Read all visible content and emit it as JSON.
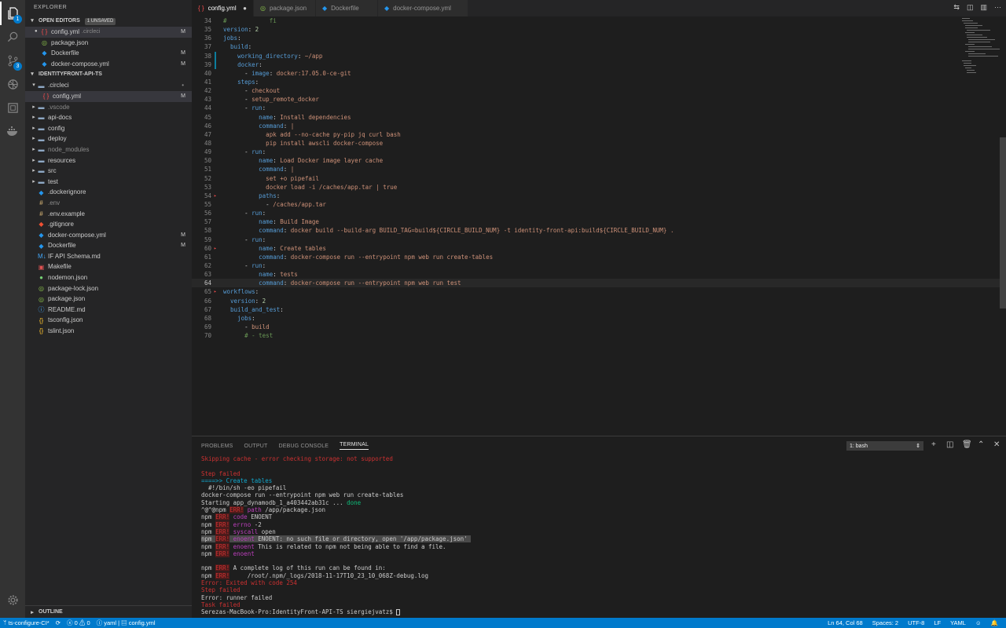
{
  "sidebar": {
    "title": "EXPLORER",
    "open_editors_label": "OPEN EDITORS",
    "unsaved_badge": "1 UNSAVED",
    "open_editors": [
      {
        "name": "config.yml",
        "detail": ".circleci",
        "flag": "M",
        "icon": "yaml-icon",
        "dirty": true
      },
      {
        "name": "package.json",
        "detail": "",
        "flag": "",
        "icon": "npm-icon",
        "dirty": false
      },
      {
        "name": "Dockerfile",
        "detail": "",
        "flag": "M",
        "icon": "docker-icon",
        "dirty": false
      },
      {
        "name": "docker-compose.yml",
        "detail": "",
        "flag": "M",
        "icon": "docker-icon",
        "dirty": false
      }
    ],
    "project_label": "IDENTITYFRONT-API-TS",
    "tree": [
      {
        "name": ".circleci",
        "type": "folder-open",
        "flag": "•",
        "indent": 0
      },
      {
        "name": "config.yml",
        "type": "yaml",
        "flag": "M",
        "indent": 1,
        "selected": true
      },
      {
        "name": ".vscode",
        "type": "folder",
        "flag": "",
        "indent": 0
      },
      {
        "name": "api-docs",
        "type": "folder",
        "flag": "",
        "indent": 0
      },
      {
        "name": "config",
        "type": "folder",
        "flag": "",
        "indent": 0
      },
      {
        "name": "deploy",
        "type": "folder",
        "flag": "",
        "indent": 0
      },
      {
        "name": "node_modules",
        "type": "folder",
        "flag": "",
        "indent": 0
      },
      {
        "name": "resources",
        "type": "folder",
        "flag": "",
        "indent": 0
      },
      {
        "name": "src",
        "type": "folder",
        "flag": "",
        "indent": 0
      },
      {
        "name": "test",
        "type": "folder",
        "flag": "",
        "indent": 0
      },
      {
        "name": ".dockerignore",
        "type": "docker",
        "flag": "",
        "indent": 0
      },
      {
        "name": ".env",
        "type": "env",
        "flag": "",
        "indent": 0
      },
      {
        "name": ".env.example",
        "type": "env",
        "flag": "",
        "indent": 0
      },
      {
        "name": ".gitignore",
        "type": "git",
        "flag": "",
        "indent": 0
      },
      {
        "name": "docker-compose.yml",
        "type": "docker",
        "flag": "M",
        "indent": 0
      },
      {
        "name": "Dockerfile",
        "type": "docker",
        "flag": "M",
        "indent": 0
      },
      {
        "name": "IF API Schema.md",
        "type": "md",
        "flag": "",
        "indent": 0
      },
      {
        "name": "Makefile",
        "type": "make",
        "flag": "",
        "indent": 0
      },
      {
        "name": "nodemon.json",
        "type": "nodemon",
        "flag": "",
        "indent": 0
      },
      {
        "name": "package-lock.json",
        "type": "npm",
        "flag": "",
        "indent": 0
      },
      {
        "name": "package.json",
        "type": "npm",
        "flag": "",
        "indent": 0
      },
      {
        "name": "README.md",
        "type": "info",
        "flag": "",
        "indent": 0
      },
      {
        "name": "tsconfig.json",
        "type": "json",
        "flag": "",
        "indent": 0
      },
      {
        "name": "tslint.json",
        "type": "json",
        "flag": "",
        "indent": 0
      }
    ],
    "outline_label": "OUTLINE"
  },
  "activity": {
    "explorer_badge": "1",
    "scm_badge": "3"
  },
  "tabs": [
    {
      "label": "config.yml",
      "active": true,
      "dirty": "●",
      "icon": "yaml-icon"
    },
    {
      "label": "package.json",
      "active": false,
      "dirty": "",
      "icon": "npm-icon"
    },
    {
      "label": "Dockerfile",
      "active": false,
      "dirty": "",
      "icon": "docker-icon"
    },
    {
      "label": "docker-compose.yml",
      "active": false,
      "dirty": "",
      "icon": "docker-icon"
    }
  ],
  "editor": {
    "current_line": "64",
    "lines": [
      {
        "n": "34",
        "t": "#            fi"
      },
      {
        "n": "35",
        "t": "version: 2"
      },
      {
        "n": "36",
        "t": "jobs:"
      },
      {
        "n": "37",
        "t": "  build:"
      },
      {
        "n": "38",
        "t": "    working_directory: ~/app"
      },
      {
        "n": "39",
        "t": "    docker:"
      },
      {
        "n": "40",
        "t": "      - image: docker:17.05.0-ce-git"
      },
      {
        "n": "41",
        "t": "    steps:"
      },
      {
        "n": "42",
        "t": "      - checkout"
      },
      {
        "n": "43",
        "t": "      - setup_remote_docker"
      },
      {
        "n": "44",
        "t": "      - run:"
      },
      {
        "n": "45",
        "t": "          name: Install dependencies"
      },
      {
        "n": "46",
        "t": "          command: |"
      },
      {
        "n": "47",
        "t": "            apk add --no-cache py-pip jq curl bash"
      },
      {
        "n": "48",
        "t": "            pip install awscli docker-compose"
      },
      {
        "n": "49",
        "t": "      - run:"
      },
      {
        "n": "50",
        "t": "          name: Load Docker image layer cache"
      },
      {
        "n": "51",
        "t": "          command: |"
      },
      {
        "n": "52",
        "t": "            set +o pipefail"
      },
      {
        "n": "53",
        "t": "            docker load -i /caches/app.tar | true"
      },
      {
        "n": "54",
        "t": "          paths:"
      },
      {
        "n": "55",
        "t": "            - /caches/app.tar"
      },
      {
        "n": "56",
        "t": "      - run:"
      },
      {
        "n": "57",
        "t": "          name: Build Image"
      },
      {
        "n": "58",
        "t": "          command: docker build --build-arg BUILD_TAG=build${CIRCLE_BUILD_NUM} -t identity-front-api:build${CIRCLE_BUILD_NUM} ."
      },
      {
        "n": "59",
        "t": "      - run:"
      },
      {
        "n": "60",
        "t": "          name: Create tables"
      },
      {
        "n": "61",
        "t": "          command: docker-compose run --entrypoint npm web run create-tables"
      },
      {
        "n": "62",
        "t": "      - run:"
      },
      {
        "n": "63",
        "t": "          name: tests"
      },
      {
        "n": "64",
        "t": "          command: docker-compose run --entrypoint npm web run test"
      },
      {
        "n": "65",
        "t": "workflows:"
      },
      {
        "n": "66",
        "t": "  version: 2"
      },
      {
        "n": "67",
        "t": "  build_and_test:"
      },
      {
        "n": "68",
        "t": "    jobs:"
      },
      {
        "n": "69",
        "t": "      - build"
      },
      {
        "n": "70",
        "t": "      # - test"
      }
    ]
  },
  "panel": {
    "tabs": [
      "PROBLEMS",
      "OUTPUT",
      "DEBUG CONSOLE",
      "TERMINAL"
    ],
    "terminal_select": "1: bash",
    "lines": [
      [
        {
          "t": "Skipping cache - error checking storage: not supported",
          "c": "red"
        }
      ],
      [
        {
          "t": "",
          "c": ""
        }
      ],
      [
        {
          "t": "Step failed",
          "c": "red"
        }
      ],
      [
        {
          "t": "====>> Create tables",
          "c": "cyan"
        }
      ],
      [
        {
          "t": "  #!/bin/sh -eo pipefail",
          "c": ""
        }
      ],
      [
        {
          "t": "docker-compose run --entrypoint npm web run create-tables",
          "c": ""
        }
      ],
      [
        {
          "t": "Starting app_dynamodb_1_a403442ab31c ... ",
          "c": ""
        },
        {
          "t": "done",
          "c": "green"
        }
      ],
      [
        {
          "t": "^@^@npm ",
          "c": ""
        },
        {
          "t": "ERR!",
          "c": "errbg"
        },
        {
          "t": " path",
          "c": "mag"
        },
        {
          "t": " /app/package.json",
          "c": ""
        }
      ],
      [
        {
          "t": "npm ",
          "c": ""
        },
        {
          "t": "ERR!",
          "c": "errbg"
        },
        {
          "t": " code",
          "c": "mag"
        },
        {
          "t": " ENOENT",
          "c": ""
        }
      ],
      [
        {
          "t": "npm ",
          "c": ""
        },
        {
          "t": "ERR!",
          "c": "errbg"
        },
        {
          "t": " errno",
          "c": "mag"
        },
        {
          "t": " -2",
          "c": ""
        }
      ],
      [
        {
          "t": "npm ",
          "c": ""
        },
        {
          "t": "ERR!",
          "c": "errbg"
        },
        {
          "t": " syscall",
          "c": "mag"
        },
        {
          "t": " open",
          "c": ""
        }
      ],
      [
        {
          "t": "npm ",
          "c": "hl"
        },
        {
          "t": "ERR!",
          "c": "errbg"
        },
        {
          "t": " enoent",
          "c": "mag hl"
        },
        {
          "t": " ENOENT: no such file or directory, open '/app/package.json' ",
          "c": "hl"
        }
      ],
      [
        {
          "t": "npm ",
          "c": ""
        },
        {
          "t": "ERR!",
          "c": "errbg"
        },
        {
          "t": " enoent",
          "c": "mag"
        },
        {
          "t": " This is related to npm not being able to find a file.",
          "c": ""
        }
      ],
      [
        {
          "t": "npm ",
          "c": ""
        },
        {
          "t": "ERR!",
          "c": "errbg"
        },
        {
          "t": " enoent",
          "c": "mag"
        }
      ],
      [
        {
          "t": "",
          "c": ""
        }
      ],
      [
        {
          "t": "npm ",
          "c": ""
        },
        {
          "t": "ERR!",
          "c": "errbg"
        },
        {
          "t": " A complete log of this run can be found in:",
          "c": ""
        }
      ],
      [
        {
          "t": "npm ",
          "c": ""
        },
        {
          "t": "ERR!",
          "c": "errbg"
        },
        {
          "t": "     /root/.npm/_logs/2018-11-17T10_23_10_068Z-debug.log",
          "c": ""
        }
      ],
      [
        {
          "t": "Error: Exited with code 254",
          "c": "red"
        }
      ],
      [
        {
          "t": "Step failed",
          "c": "red"
        }
      ],
      [
        {
          "t": "Error: runner failed",
          "c": ""
        }
      ],
      [
        {
          "t": "Task failed",
          "c": "red"
        }
      ],
      [
        {
          "t": "Serezas-MacBook-Pro:IdentityFront-API-TS siergiejvatz$ ",
          "c": ""
        }
      ]
    ]
  },
  "status": {
    "branch": "ts-configure-CI*",
    "errors": "0",
    "warnings": "0",
    "language_file": "yaml | ",
    "file": "config.yml",
    "position": "Ln 64, Col 68",
    "spaces": "Spaces: 2",
    "encoding": "UTF-8",
    "eol": "LF",
    "language": "YAML"
  }
}
